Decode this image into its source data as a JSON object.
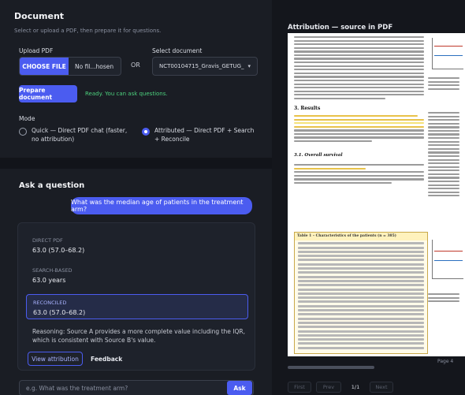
{
  "document": {
    "title": "Document",
    "subtitle": "Select or upload a PDF, then prepare it for questions.",
    "upload_label": "Upload PDF",
    "choose_file_label": "CHOOSE FILE",
    "file_name": "No fil...hosen",
    "or_label": "OR",
    "select_label": "Select document",
    "selected_document": "NCT00104715_Gravis_GETUG_",
    "prepare_label": "Prepare document",
    "status": "Ready. You can ask questions.",
    "mode_label": "Mode",
    "mode_quick": "Quick — Direct PDF chat (faster, no attribution)",
    "mode_attributed": "Attributed — Direct PDF + Search + Reconcile"
  },
  "ask": {
    "title": "Ask a question",
    "question": "What was the median age of patients in the treatment arm?",
    "direct_label": "DIRECT PDF",
    "direct_value": "63.0 (57.0–68.2)",
    "search_label": "SEARCH-BASED",
    "search_value": "63.0 years",
    "reconciled_label": "RECONCILED",
    "reconciled_value": "63.0 (57.0–68.2)",
    "reasoning": "Reasoning: Source A provides a more complete value including the IQR, which is consistent with Source B's value.",
    "view_attribution": "View attribution",
    "feedback": "Feedback",
    "input_placeholder": "e.g. What was the treatment arm?",
    "ask_button": "Ask"
  },
  "attribution": {
    "title": "Attribution — source in PDF",
    "results_heading": "3.     Results",
    "survival_heading": "3.1.     Overall survival",
    "table_caption": "Table 1 – Characteristics of the patients (n = 385)",
    "page_label": "Page 4",
    "first_label": "First",
    "prev_label": "Prev",
    "page_count": "1/1",
    "next_label": "Next"
  },
  "colors": {
    "accent": "#4b5cf0",
    "success": "#4cd07d",
    "highlight": "#e8c24a"
  }
}
